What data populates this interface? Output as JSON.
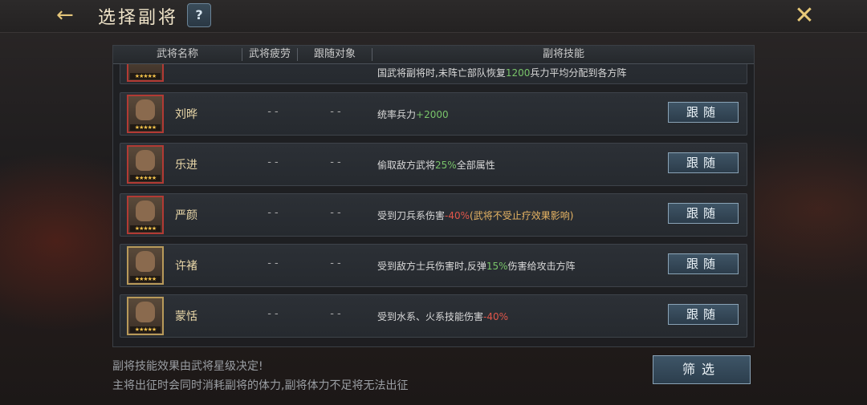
{
  "header": {
    "title": "选择副将",
    "help_label": "?",
    "back_icon": "←",
    "close_icon": "✕"
  },
  "table": {
    "columns": [
      "武将名称",
      "武将疲劳",
      "跟随对象",
      "副将技能"
    ],
    "partial_row": {
      "skill_text": "国武将副将时,未阵亡部队恢复",
      "skill_value": "1200",
      "skill_suffix": "兵力平均分配到各方阵"
    },
    "rows": [
      {
        "name": "刘晔",
        "fatigue": "- -",
        "target": "- -",
        "skill_pre": "统率兵力",
        "skill_val": "+2000",
        "skill_val_color": "green",
        "skill_post": "",
        "button": "跟随"
      },
      {
        "name": "乐进",
        "fatigue": "- -",
        "target": "- -",
        "skill_pre": "偷取敌方武将",
        "skill_val": "25%",
        "skill_val_color": "green",
        "skill_post": "全部属性",
        "button": "跟随"
      },
      {
        "name": "严颜",
        "fatigue": "- -",
        "target": "- -",
        "skill_pre": "受到刀兵系伤害",
        "skill_val": "-40%",
        "skill_val_color": "red",
        "skill_post": "(武将不受止疗效果影响)",
        "button": "跟随"
      },
      {
        "name": "许褚",
        "fatigue": "- -",
        "target": "- -",
        "skill_pre": "受到敌方士兵伤害时,反弹",
        "skill_val": "15%",
        "skill_val_color": "green",
        "skill_post": "伤害给攻击方阵",
        "button": "跟随"
      },
      {
        "name": "蒙恬",
        "fatigue": "- -",
        "target": "- -",
        "skill_pre": "受到水系、火系技能伤害",
        "skill_val": "-40%",
        "skill_val_color": "red",
        "skill_post": "",
        "button": "跟随"
      }
    ]
  },
  "footer": {
    "note1": "副将技能效果由武将星级决定!",
    "note2": "主将出征时会同时消耗副将的体力,副将体力不足将无法出征",
    "filter_label": "筛选"
  },
  "stars_glyph": "★★★★★"
}
